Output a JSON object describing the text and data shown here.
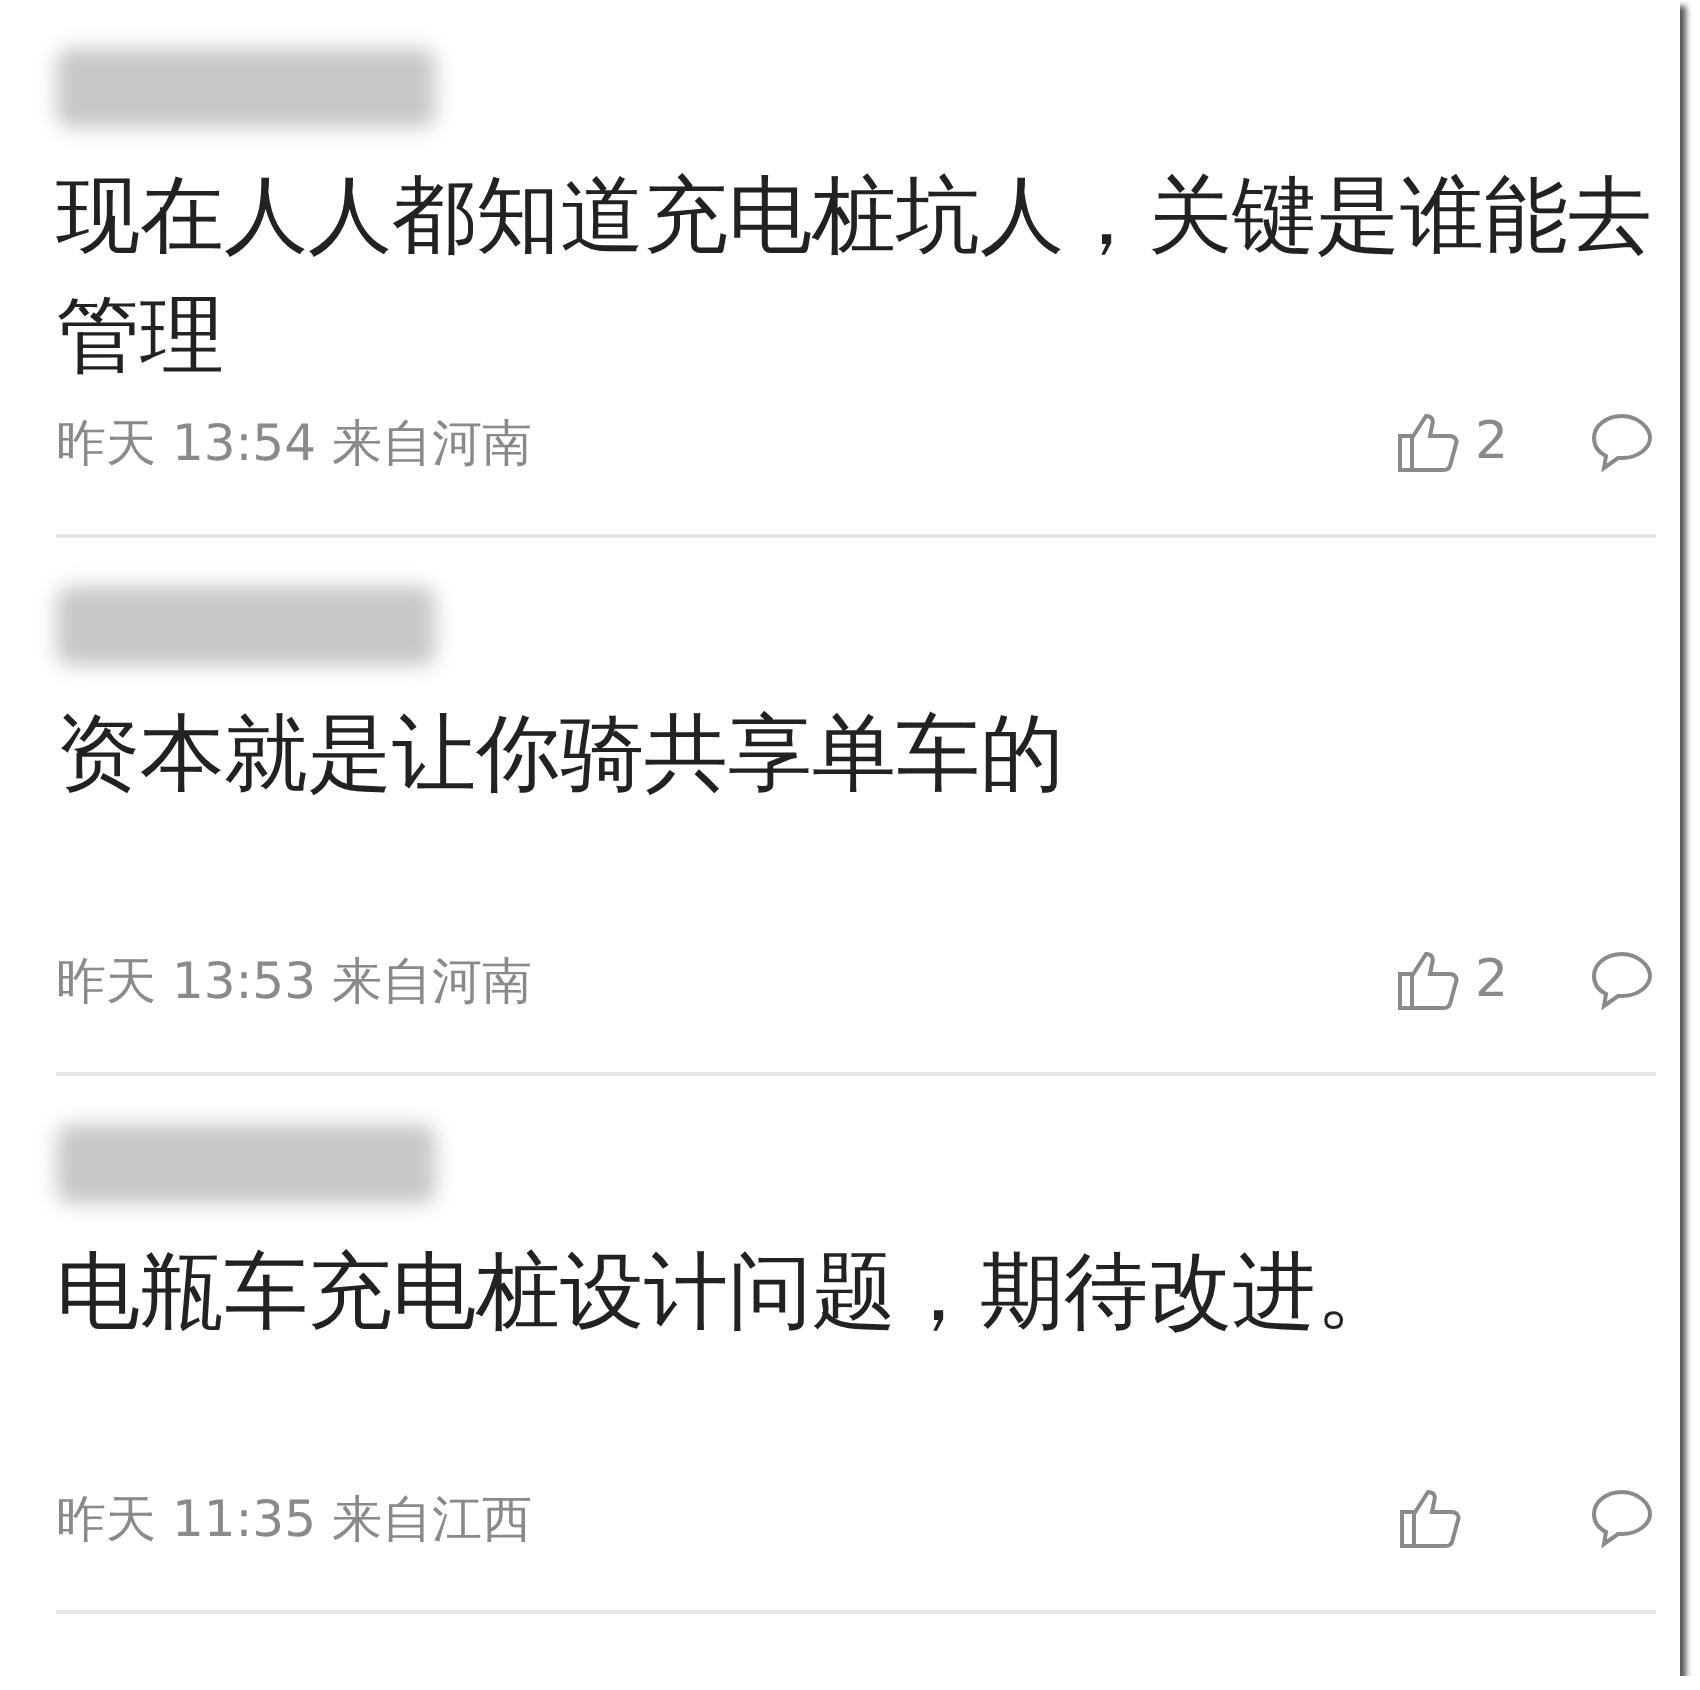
{
  "comments": [
    {
      "text": "现在人人都知道充电桩坑人，关键是谁能去管理",
      "meta": "昨天 13:54 来自河南",
      "likes": "2"
    },
    {
      "text": "资本就是让你骑共享单车的",
      "meta": "昨天 13:53 来自河南",
      "likes": "2"
    },
    {
      "text": "电瓶车充电桩设计问题，期待改进。",
      "meta": "昨天 11:35 来自江西"
    }
  ]
}
